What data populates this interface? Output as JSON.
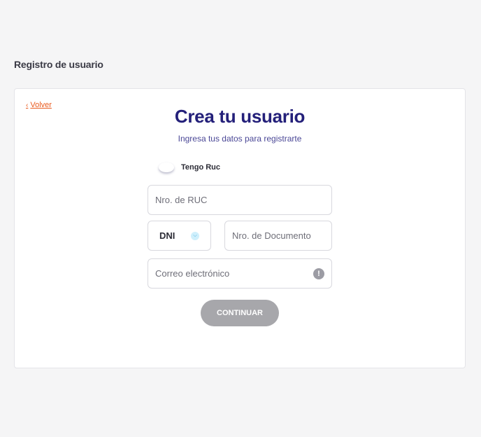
{
  "page": {
    "heading": "Registro de usuario"
  },
  "card": {
    "back_label": "Volver",
    "title": "Crea tu usuario",
    "subtitle": "Ingresa tus datos para registrarte",
    "ruc_toggle": {
      "label": "Tengo Ruc",
      "checked": false
    }
  },
  "form": {
    "ruc": {
      "placeholder": "Nro. de RUC",
      "value": ""
    },
    "document_type": {
      "selected": "DNI"
    },
    "document_number": {
      "placeholder": "Nro. de Documento",
      "value": ""
    },
    "email": {
      "placeholder": "Correo electrónico",
      "value": ""
    },
    "continue_label": "CONTINUAR"
  },
  "icons": {
    "back": "chevron-left-icon",
    "select": "chevron-down-icon",
    "email_info": "exclamation-icon"
  },
  "colors": {
    "accent_link": "#ea5a1e",
    "title": "#24207a",
    "subtitle": "#4a4796",
    "button_disabled": "#a7a7ab",
    "select_chevron": "#2aa4d8"
  }
}
